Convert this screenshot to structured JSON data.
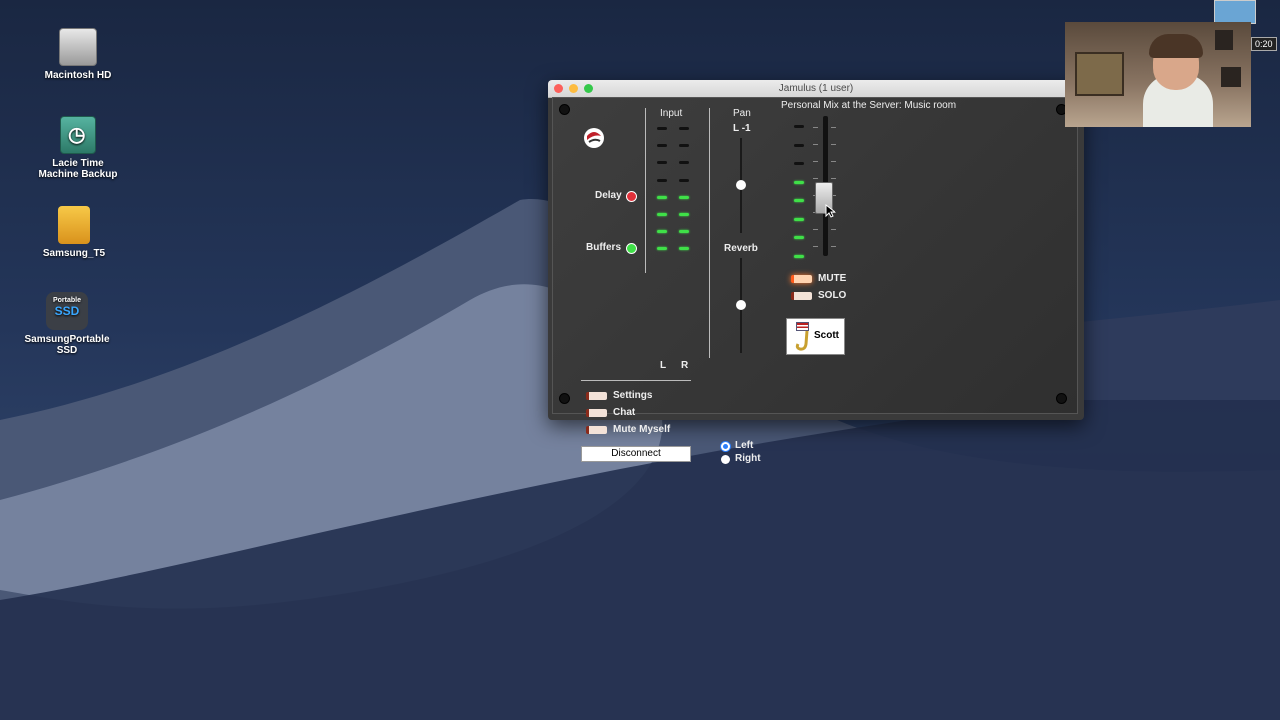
{
  "desktop": {
    "icons": [
      {
        "label": "Macintosh HD"
      },
      {
        "label": "Lacie Time\nMachine Backup"
      },
      {
        "label": "Samsung_T5"
      },
      {
        "label": "SamsungPortable\nSSD",
        "badge_top": "Portable",
        "badge_main": "SSD"
      }
    ]
  },
  "window": {
    "title": "Jamulus (1 user)",
    "input_label": "Input",
    "meter_left": "L",
    "meter_right": "R",
    "delay_label": "Delay",
    "buffers_label": "Buffers",
    "pan_label": "Pan",
    "pan_value": "L -1",
    "reverb_label": "Reverb",
    "reverb_channel_options": [
      "Left",
      "Right"
    ],
    "reverb_channel_selected": "Left",
    "settings_label": "Settings",
    "chat_label": "Chat",
    "mute_myself_label": "Mute Myself",
    "disconnect_label": "Disconnect",
    "mix_title": "Personal Mix at the Server: Music room",
    "channel": {
      "name": "Scott",
      "mute_label": "MUTE",
      "solo_label": "SOLO"
    },
    "colors": {
      "delay_led": "#e0303a",
      "buffers_led": "#3fe048",
      "meter_on": "#3fe048"
    }
  },
  "overlay": {
    "timer": "0:20"
  }
}
